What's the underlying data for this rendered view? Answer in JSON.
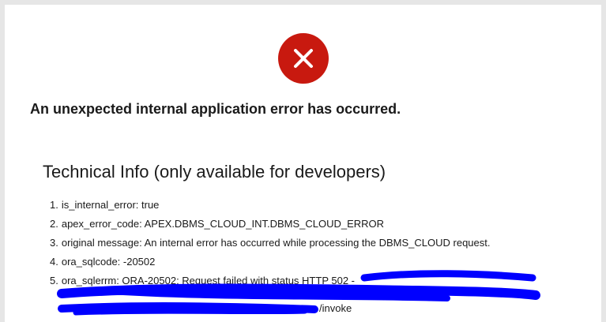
{
  "page": {
    "headline": "An unexpected internal application error has occurred.",
    "technical_title": "Technical Info (only available for developers)"
  },
  "icons": {
    "error": "error-x-icon"
  },
  "colors": {
    "error_red": "#c8190f",
    "redaction_blue": "#0000ff"
  },
  "info": {
    "items": [
      {
        "num": "1.",
        "text": "is_internal_error: true"
      },
      {
        "num": "2.",
        "text": "apex_error_code: APEX.DBMS_CLOUD_INT.DBMS_CLOUD_ERROR"
      },
      {
        "num": "3.",
        "text": "original message: An internal error has occurred while processing the DBMS_CLOUD request."
      },
      {
        "num": "4.",
        "text": "ora_sqlcode: -20502"
      },
      {
        "num": "5.",
        "text": "ora_sqlerrm: ORA-20502: Request failed with status HTTP 502 -"
      }
    ],
    "tail": "/invoke"
  }
}
